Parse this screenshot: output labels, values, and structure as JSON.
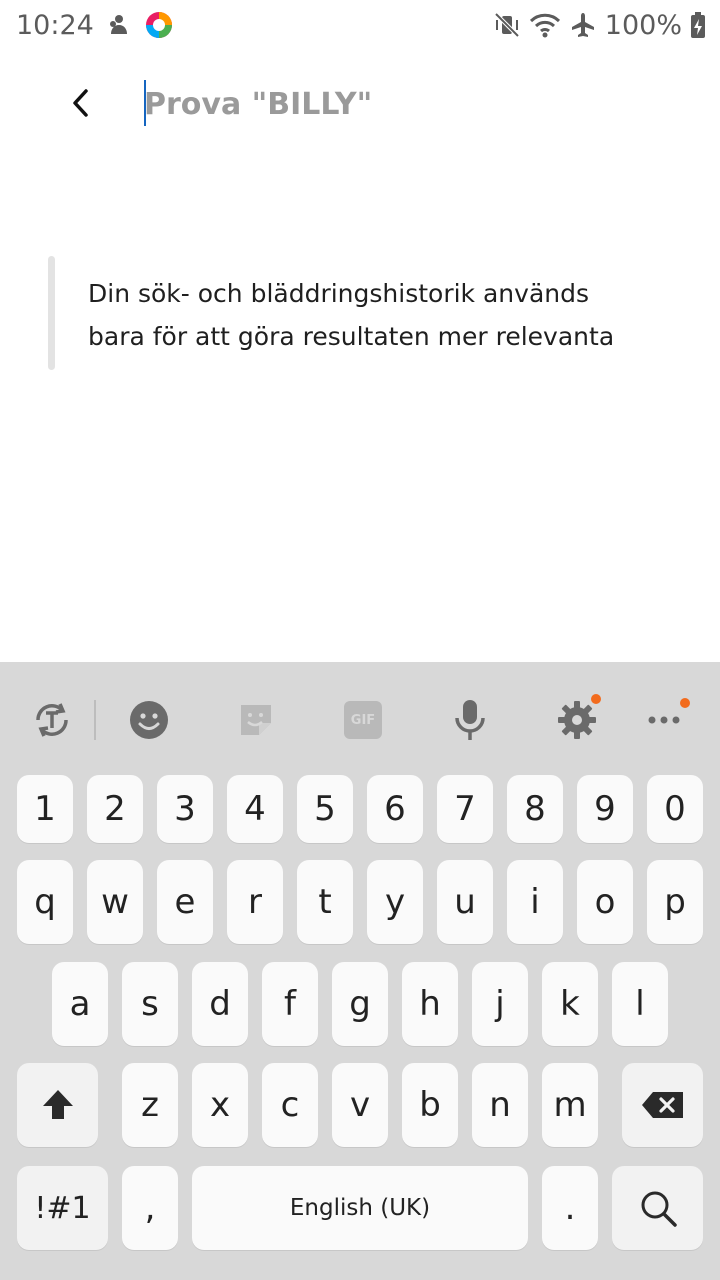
{
  "status_bar": {
    "time": "10:24",
    "battery": "100%",
    "icons": [
      "notification-app-icon",
      "browser-app-icon",
      "vibrate-mute-icon",
      "wifi-icon",
      "airplane-mode-icon",
      "battery-charging-icon"
    ]
  },
  "search": {
    "placeholder": "Prova \"BILLY\"",
    "value": ""
  },
  "info": {
    "line1": "Din sök- och bläddringshistorik används",
    "line2": "bara för att göra resultaten mer relevanta"
  },
  "keyboard": {
    "toolbar": [
      "text-translate-icon",
      "emoji-icon",
      "sticker-icon",
      "gif-icon",
      "microphone-icon",
      "settings-icon",
      "more-icon"
    ],
    "gif_label": "GIF",
    "number_row": [
      "1",
      "2",
      "3",
      "4",
      "5",
      "6",
      "7",
      "8",
      "9",
      "0"
    ],
    "row1": [
      "q",
      "w",
      "e",
      "r",
      "t",
      "y",
      "u",
      "i",
      "o",
      "p"
    ],
    "row2": [
      "a",
      "s",
      "d",
      "f",
      "g",
      "h",
      "j",
      "k",
      "l"
    ],
    "row3": [
      "z",
      "x",
      "c",
      "v",
      "b",
      "n",
      "m"
    ],
    "symbols_label": "!#1",
    "comma_label": ",",
    "space_label": "English (UK)",
    "period_label": "."
  },
  "colors": {
    "accent_dot": "#f26b1d",
    "caret": "#1565c0",
    "keyboard_bg": "#d8d8d8"
  }
}
